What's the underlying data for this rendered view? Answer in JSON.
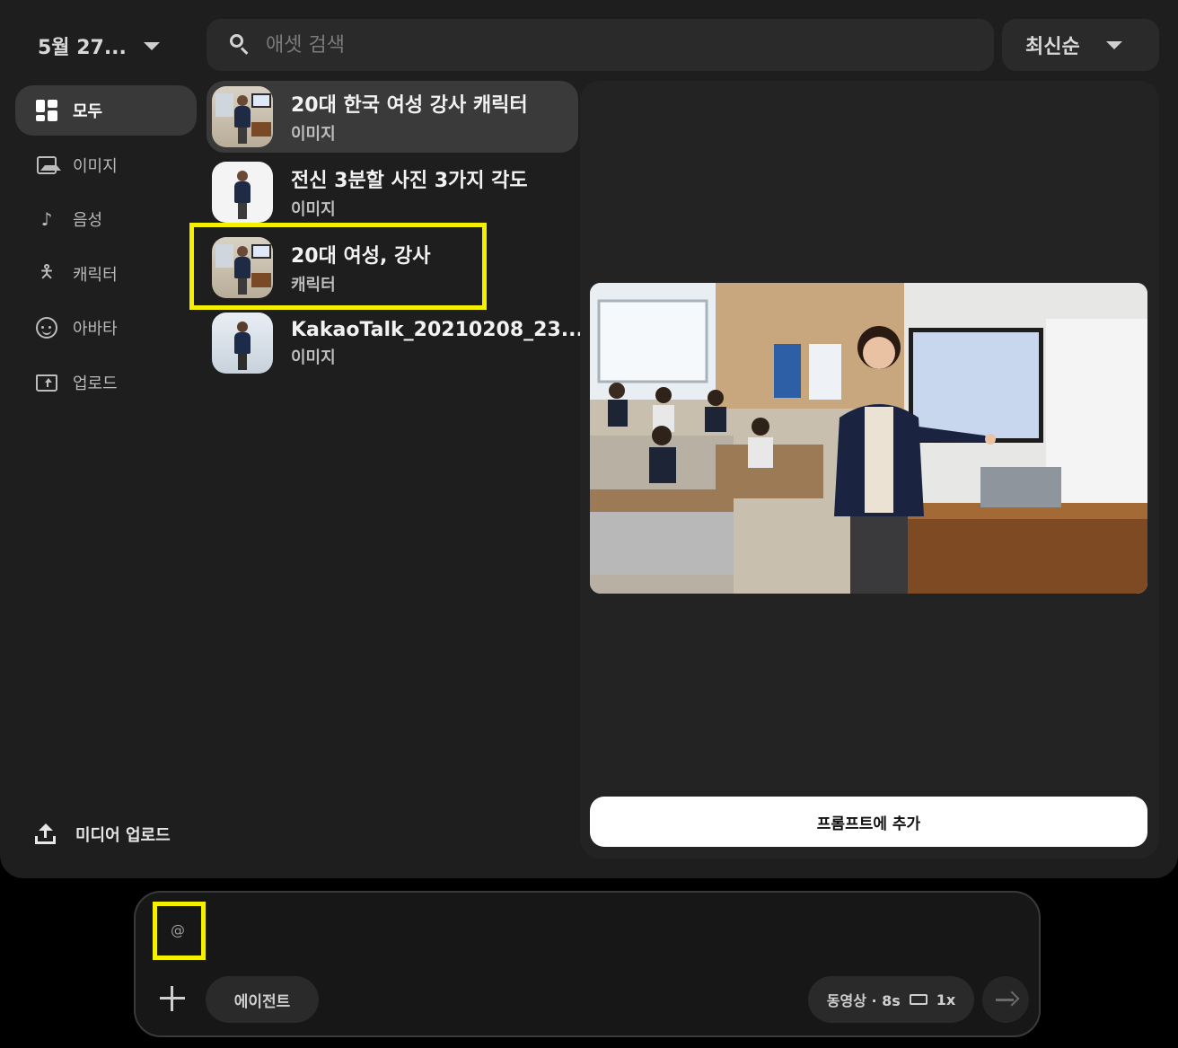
{
  "header": {
    "date_filter": "5월 27...",
    "search_placeholder": "애셋 검색",
    "sort_label": "최신순"
  },
  "sidebar": {
    "items": [
      {
        "label": "모두",
        "icon": "grid-icon",
        "active": true
      },
      {
        "label": "이미지",
        "icon": "image-icon"
      },
      {
        "label": "음성",
        "icon": "voice-icon"
      },
      {
        "label": "캐릭터",
        "icon": "person-icon"
      },
      {
        "label": "아바타",
        "icon": "face-icon"
      },
      {
        "label": "업로드",
        "icon": "upload-folder-icon"
      }
    ],
    "media_upload_label": "미디어 업로드"
  },
  "assets": [
    {
      "title": "20대 한국 여성 강사 캐릭터",
      "type": "이미지",
      "selected": true
    },
    {
      "title": "전신 3분할 사진 3가지 각도",
      "type": "이미지"
    },
    {
      "title": "20대 여성, 강사",
      "type": "캐릭터",
      "highlighted": true
    },
    {
      "title": "KakaoTalk_20210208_23...",
      "type": "이미지"
    }
  ],
  "preview": {
    "add_to_prompt_label": "프롬프트에 추가"
  },
  "composer": {
    "mention_symbol": "@",
    "agent_label": "에이전트",
    "settings_label": "동영상 · 8s",
    "multiplier": "1x"
  },
  "colors": {
    "panel": "#1e1e1f",
    "highlight": "#f4f000",
    "selected_row": "#3a3a3b"
  }
}
